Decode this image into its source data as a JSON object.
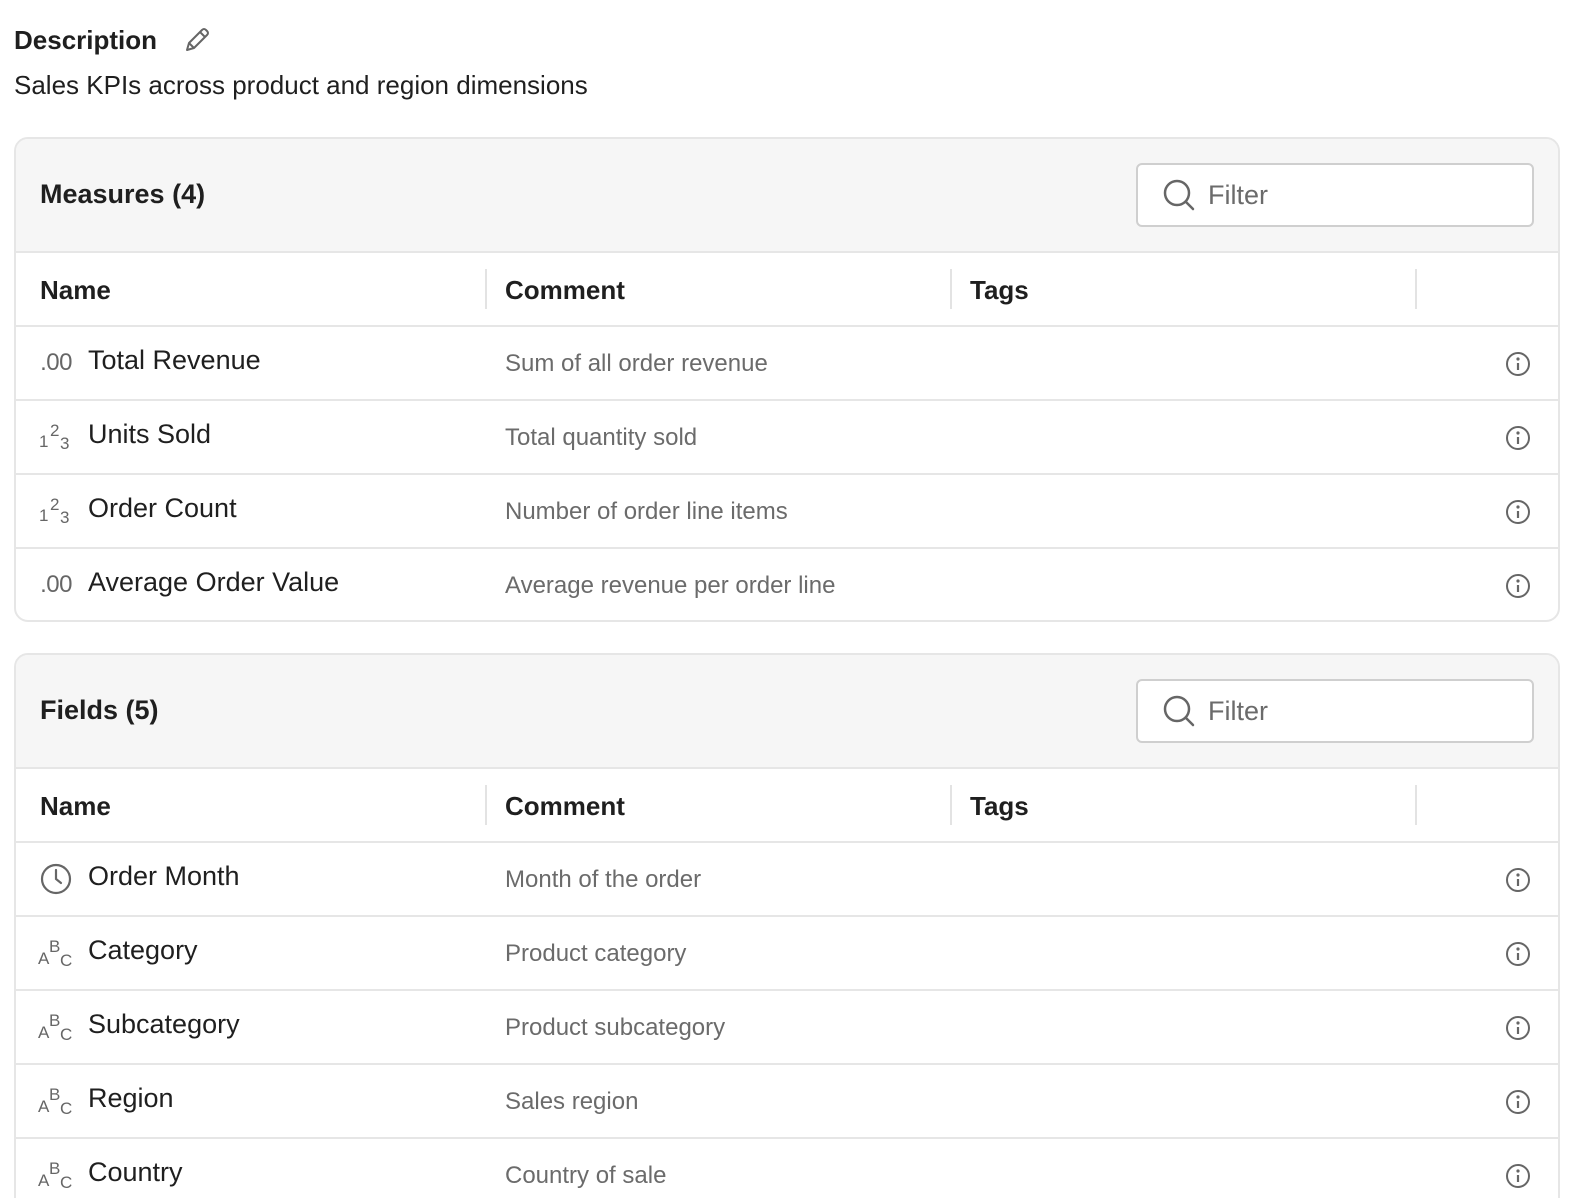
{
  "description": {
    "title": "Description",
    "text": "Sales KPIs across product and region dimensions",
    "edit_icon": "pencil-icon"
  },
  "columns": {
    "name": "Name",
    "comment": "Comment",
    "tags": "Tags"
  },
  "measures": {
    "title": "Measures (4)",
    "filter_placeholder": "Filter",
    "rows": [
      {
        "type": "decimal",
        "type_label": ".00",
        "name": "Total Revenue",
        "comment": "Sum of all order revenue"
      },
      {
        "type": "integer",
        "type_label": "123",
        "name": "Units Sold",
        "comment": "Total quantity sold"
      },
      {
        "type": "integer",
        "type_label": "123",
        "name": "Order Count",
        "comment": "Number of order line items"
      },
      {
        "type": "decimal",
        "type_label": ".00",
        "name": "Average Order Value",
        "comment": "Average revenue per order line"
      }
    ]
  },
  "fields": {
    "title": "Fields (5)",
    "filter_placeholder": "Filter",
    "rows": [
      {
        "type": "time",
        "name": "Order Month",
        "comment": "Month of the order"
      },
      {
        "type": "string",
        "type_label": "ABC",
        "name": "Category",
        "comment": "Product category"
      },
      {
        "type": "string",
        "type_label": "ABC",
        "name": "Subcategory",
        "comment": "Product subcategory"
      },
      {
        "type": "string",
        "type_label": "ABC",
        "name": "Region",
        "comment": "Sales region"
      },
      {
        "type": "string",
        "type_label": "ABC",
        "name": "Country",
        "comment": "Country of sale"
      }
    ]
  }
}
